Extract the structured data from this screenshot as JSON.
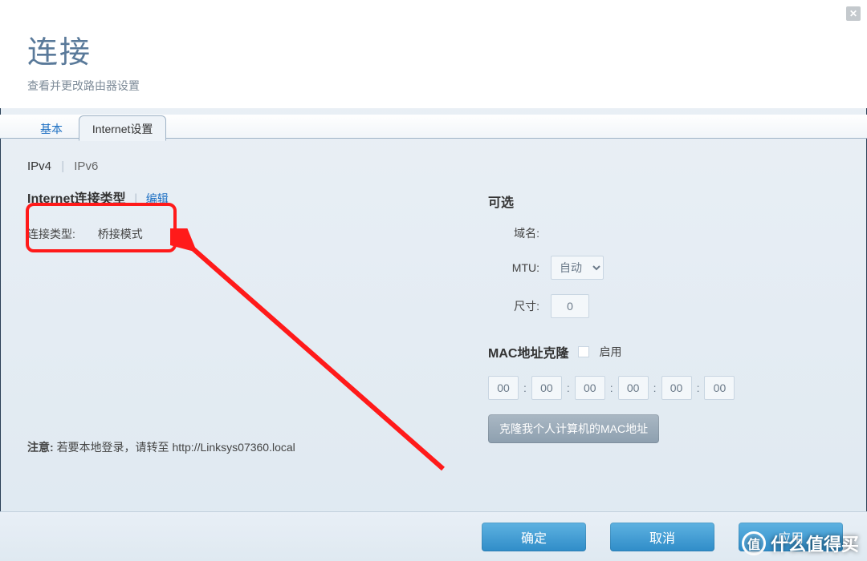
{
  "header": {
    "title": "连接",
    "subtitle": "查看并更改路由器设置"
  },
  "tabs": {
    "basic": "基本",
    "internet": "Internet设置"
  },
  "ipswitch": {
    "v4": "IPv4",
    "v6": "IPv6"
  },
  "conn": {
    "section": "Internet连接类型",
    "edit": "编辑",
    "type_label": "连接类型:",
    "type_value": "桥接模式"
  },
  "note": {
    "label": "注意:",
    "text": "若要本地登录，请转至 http://Linksys07360.local"
  },
  "optional": {
    "heading": "可选",
    "domain_label": "域名:",
    "mtu_label": "MTU:",
    "mtu_value": "自动",
    "size_label": "尺寸:",
    "size_value": "0"
  },
  "mac": {
    "heading": "MAC地址克隆",
    "enable": "启用",
    "octets": [
      "00",
      "00",
      "00",
      "00",
      "00",
      "00"
    ],
    "clone_btn": "克隆我个人计算机的MAC地址"
  },
  "footer": {
    "ok": "确定",
    "cancel": "取消",
    "apply": "应用"
  },
  "watermark": "什么值得买"
}
